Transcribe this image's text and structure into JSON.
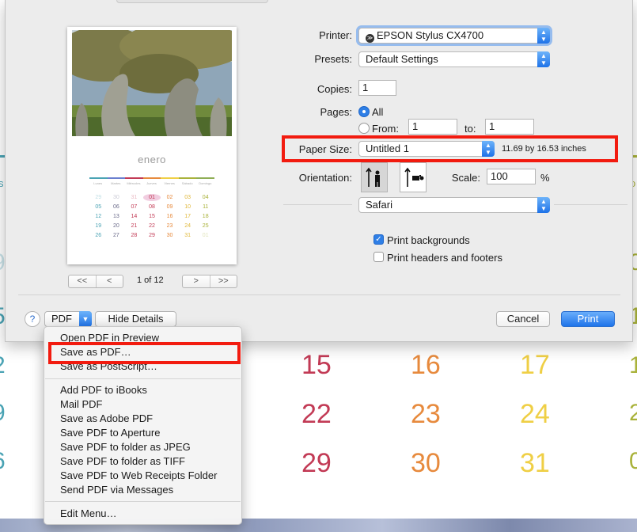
{
  "background": {
    "numbers": [
      {
        "text": "15",
        "color": "#c23a55"
      },
      {
        "text": "16",
        "color": "#e78a3d"
      },
      {
        "text": "17",
        "color": "#efcf45"
      },
      {
        "text": "22",
        "color": "#c23a55"
      },
      {
        "text": "23",
        "color": "#e78a3d"
      },
      {
        "text": "24",
        "color": "#efcf45"
      },
      {
        "text": "29",
        "color": "#c23a55"
      },
      {
        "text": "30",
        "color": "#e78a3d"
      },
      {
        "text": "31",
        "color": "#efcf45"
      }
    ],
    "left_edge": [
      "9",
      "5",
      "2",
      "9",
      "6"
    ],
    "right_edge": [
      "0",
      "1",
      "1",
      "2",
      "0"
    ],
    "left_edge_small": "s",
    "right_edge_small": "o"
  },
  "preview": {
    "month": "enero",
    "day_headers": [
      "Lunes",
      "Martes",
      "Miércoles",
      "Jueves",
      "Viernes",
      "Sábado",
      "Domingo"
    ],
    "days": [
      "29",
      "30",
      "31",
      "01",
      "02",
      "03",
      "04",
      "05",
      "06",
      "07",
      "08",
      "09",
      "10",
      "11",
      "12",
      "13",
      "14",
      "15",
      "16",
      "17",
      "18",
      "19",
      "20",
      "21",
      "22",
      "23",
      "24",
      "25",
      "26",
      "27",
      "28",
      "29",
      "30",
      "31",
      "01"
    ],
    "highlight_index": 3,
    "strip_colors": [
      "#4aa3b4",
      "#6a7fcf",
      "#c23a55",
      "#e78a3d",
      "#efcf45",
      "#a9b23a",
      "#8fae55"
    ],
    "column_colors": [
      "#4aa3b4",
      "#6b6b8a",
      "#c23a55",
      "#c23a55",
      "#e78a3d",
      "#e0b83a",
      "#a9b23a"
    ],
    "page_label": "1 of 12",
    "nav_first": "<<",
    "nav_prev": "<",
    "nav_next": ">",
    "nav_last": ">>"
  },
  "form": {
    "printer_label": "Printer:",
    "printer_value": "EPSON Stylus CX4700",
    "presets_label": "Presets:",
    "presets_value": "Default Settings",
    "copies_label": "Copies:",
    "copies_value": "1",
    "pages_label": "Pages:",
    "pages_all": "All",
    "pages_from": "From:",
    "pages_from_value": "1",
    "pages_to": "to:",
    "pages_to_value": "1",
    "paper_size_label": "Paper Size:",
    "paper_size_value": "Untitled 1",
    "paper_size_dims": "11.69 by 16.53 inches",
    "orientation_label": "Orientation:",
    "scale_label": "Scale:",
    "scale_value": "100",
    "scale_unit": "%",
    "app_section": "Safari",
    "print_backgrounds": "Print backgrounds",
    "print_headers": "Print headers and footers"
  },
  "buttons": {
    "help": "?",
    "pdf": "PDF",
    "hide_details": "Hide Details",
    "cancel": "Cancel",
    "print": "Print"
  },
  "pdf_menu": {
    "group1": [
      "Open PDF in Preview",
      "Save as PDF…",
      "Save as PostScript…"
    ],
    "group2": [
      "Add PDF to iBooks",
      "Mail PDF",
      "Save as Adobe PDF",
      "Save PDF to Aperture",
      "Save PDF to folder as JPEG",
      "Save PDF to folder as TIFF",
      "Save PDF to Web Receipts Folder",
      "Send PDF via Messages"
    ],
    "group3": [
      "Edit Menu…"
    ]
  },
  "highlight_color": "#f21b0f",
  "accent_color": "#2f7fe6"
}
